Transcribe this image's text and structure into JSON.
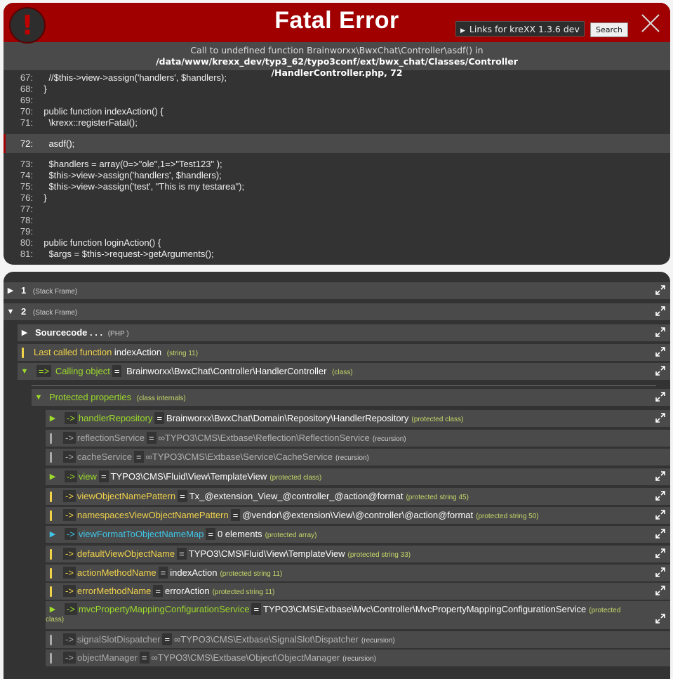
{
  "header": {
    "title": "Fatal Error",
    "icon_glyph": "!",
    "links_label": "Links for kreXX 1.3.6 dev",
    "search_label": "Search"
  },
  "message": {
    "text": "Call to undefined function Brainworxx\\BwxChat\\Controller\\asdf() in",
    "path_line1": "/data/www/krexx_dev/typ3_62/typo3conf/ext/bwx_chat/Classes/Controller",
    "path_line2": "/HandlerController.php, 72"
  },
  "code_lines": [
    {
      "ln": "67:",
      "src": "    //$this->view->assign('handlers', $handlers);"
    },
    {
      "ln": "68:",
      "src": "  }"
    },
    {
      "ln": "69:",
      "src": ""
    },
    {
      "ln": "70:",
      "src": "  public function indexAction() {"
    },
    {
      "ln": "71:",
      "src": "    \\krexx::registerFatal();"
    },
    {
      "ln": "72:",
      "src": "    asdf();",
      "highlight": true
    },
    {
      "ln": "73:",
      "src": "    $handlers = array(0=>\"ole\",1=>\"Test123\" );"
    },
    {
      "ln": "74:",
      "src": "    $this->view->assign('handlers', $handlers);"
    },
    {
      "ln": "75:",
      "src": "    $this->view->assign('test', \"This is my testarea\");"
    },
    {
      "ln": "76:",
      "src": "  }"
    },
    {
      "ln": "77:",
      "src": ""
    },
    {
      "ln": "78:",
      "src": ""
    },
    {
      "ln": "79:",
      "src": ""
    },
    {
      "ln": "80:",
      "src": "  public function loginAction() {"
    },
    {
      "ln": "81:",
      "src": "    $args = $this->request->getArguments();"
    }
  ],
  "dump": {
    "frame1": {
      "num": "1",
      "label": "(Stack Frame)"
    },
    "frame2": {
      "num": "2",
      "label": "(Stack Frame)"
    },
    "sourcecode": {
      "label": "Sourcecode . . .",
      "type": "(PHP )"
    },
    "last_called": {
      "key": "Last called function",
      "value": "indexAction",
      "type": "(string 11)"
    },
    "calling": {
      "arrow": "=>",
      "key": "Calling object",
      "eq": "=",
      "value": "Brainworxx\\BwxChat\\Controller\\HandlerController",
      "type": "(class)"
    },
    "protected": {
      "key": "Protected properties",
      "type": "(class internals)"
    },
    "props": [
      {
        "name": "handlerRepository",
        "value": "Brainworxx\\BwxChat\\Domain\\Repository\\HandlerRepository",
        "type": "(protected class)"
      },
      {
        "name": "reflectionService",
        "value": "∞TYPO3\\CMS\\Extbase\\Reflection\\ReflectionService",
        "type": "(recursion)"
      },
      {
        "name": "cacheService",
        "value": "∞TYPO3\\CMS\\Extbase\\Service\\CacheService",
        "type": "(recursion)"
      },
      {
        "name": "view",
        "value": "TYPO3\\CMS\\Fluid\\View\\TemplateView",
        "type": "(protected class)"
      },
      {
        "name": "viewObjectNamePattern",
        "value": "Tx_@extension_View_@controller_@action@format",
        "type": "(protected string 45)"
      },
      {
        "name": "namespacesViewObjectNamePattern",
        "value": "@vendor\\@extension\\View\\@controller\\@action@format",
        "type": "(protected string 50)"
      },
      {
        "name": "viewFormatToObjectNameMap",
        "value": "0 elements",
        "type": "(protected array)"
      },
      {
        "name": "defaultViewObjectName",
        "value": "TYPO3\\CMS\\Fluid\\View\\TemplateView",
        "type": "(protected string 33)"
      },
      {
        "name": "actionMethodName",
        "value": "indexAction",
        "type": "(protected string 11)"
      },
      {
        "name": "errorMethodName",
        "value": "errorAction",
        "type": "(protected string 11)"
      },
      {
        "name": "mvcPropertyMappingConfigurationService",
        "value": "TYPO3\\CMS\\Extbase\\Mvc\\Controller\\MvcPropertyMappingConfigurationService",
        "type": "(protected",
        "type2": "class)"
      },
      {
        "name": "signalSlotDispatcher",
        "value": "∞TYPO3\\CMS\\Extbase\\SignalSlot\\Dispatcher",
        "type": "(recursion)"
      },
      {
        "name": "objectManager",
        "value": "∞TYPO3\\CMS\\Extbase\\Object\\ObjectManager",
        "type": "(recursion)"
      }
    ],
    "arrow_label": "->",
    "eq_label": "=",
    "colors": {
      "string": "#f1d34a",
      "class": "#9ddc2a",
      "array": "#3fc6e8",
      "recursion": "#aaaaaa"
    },
    "icons": {
      "collapsed": "triangle-right-icon",
      "expanded": "triangle-down-icon",
      "copy": "expand-arrows-icon"
    }
  }
}
